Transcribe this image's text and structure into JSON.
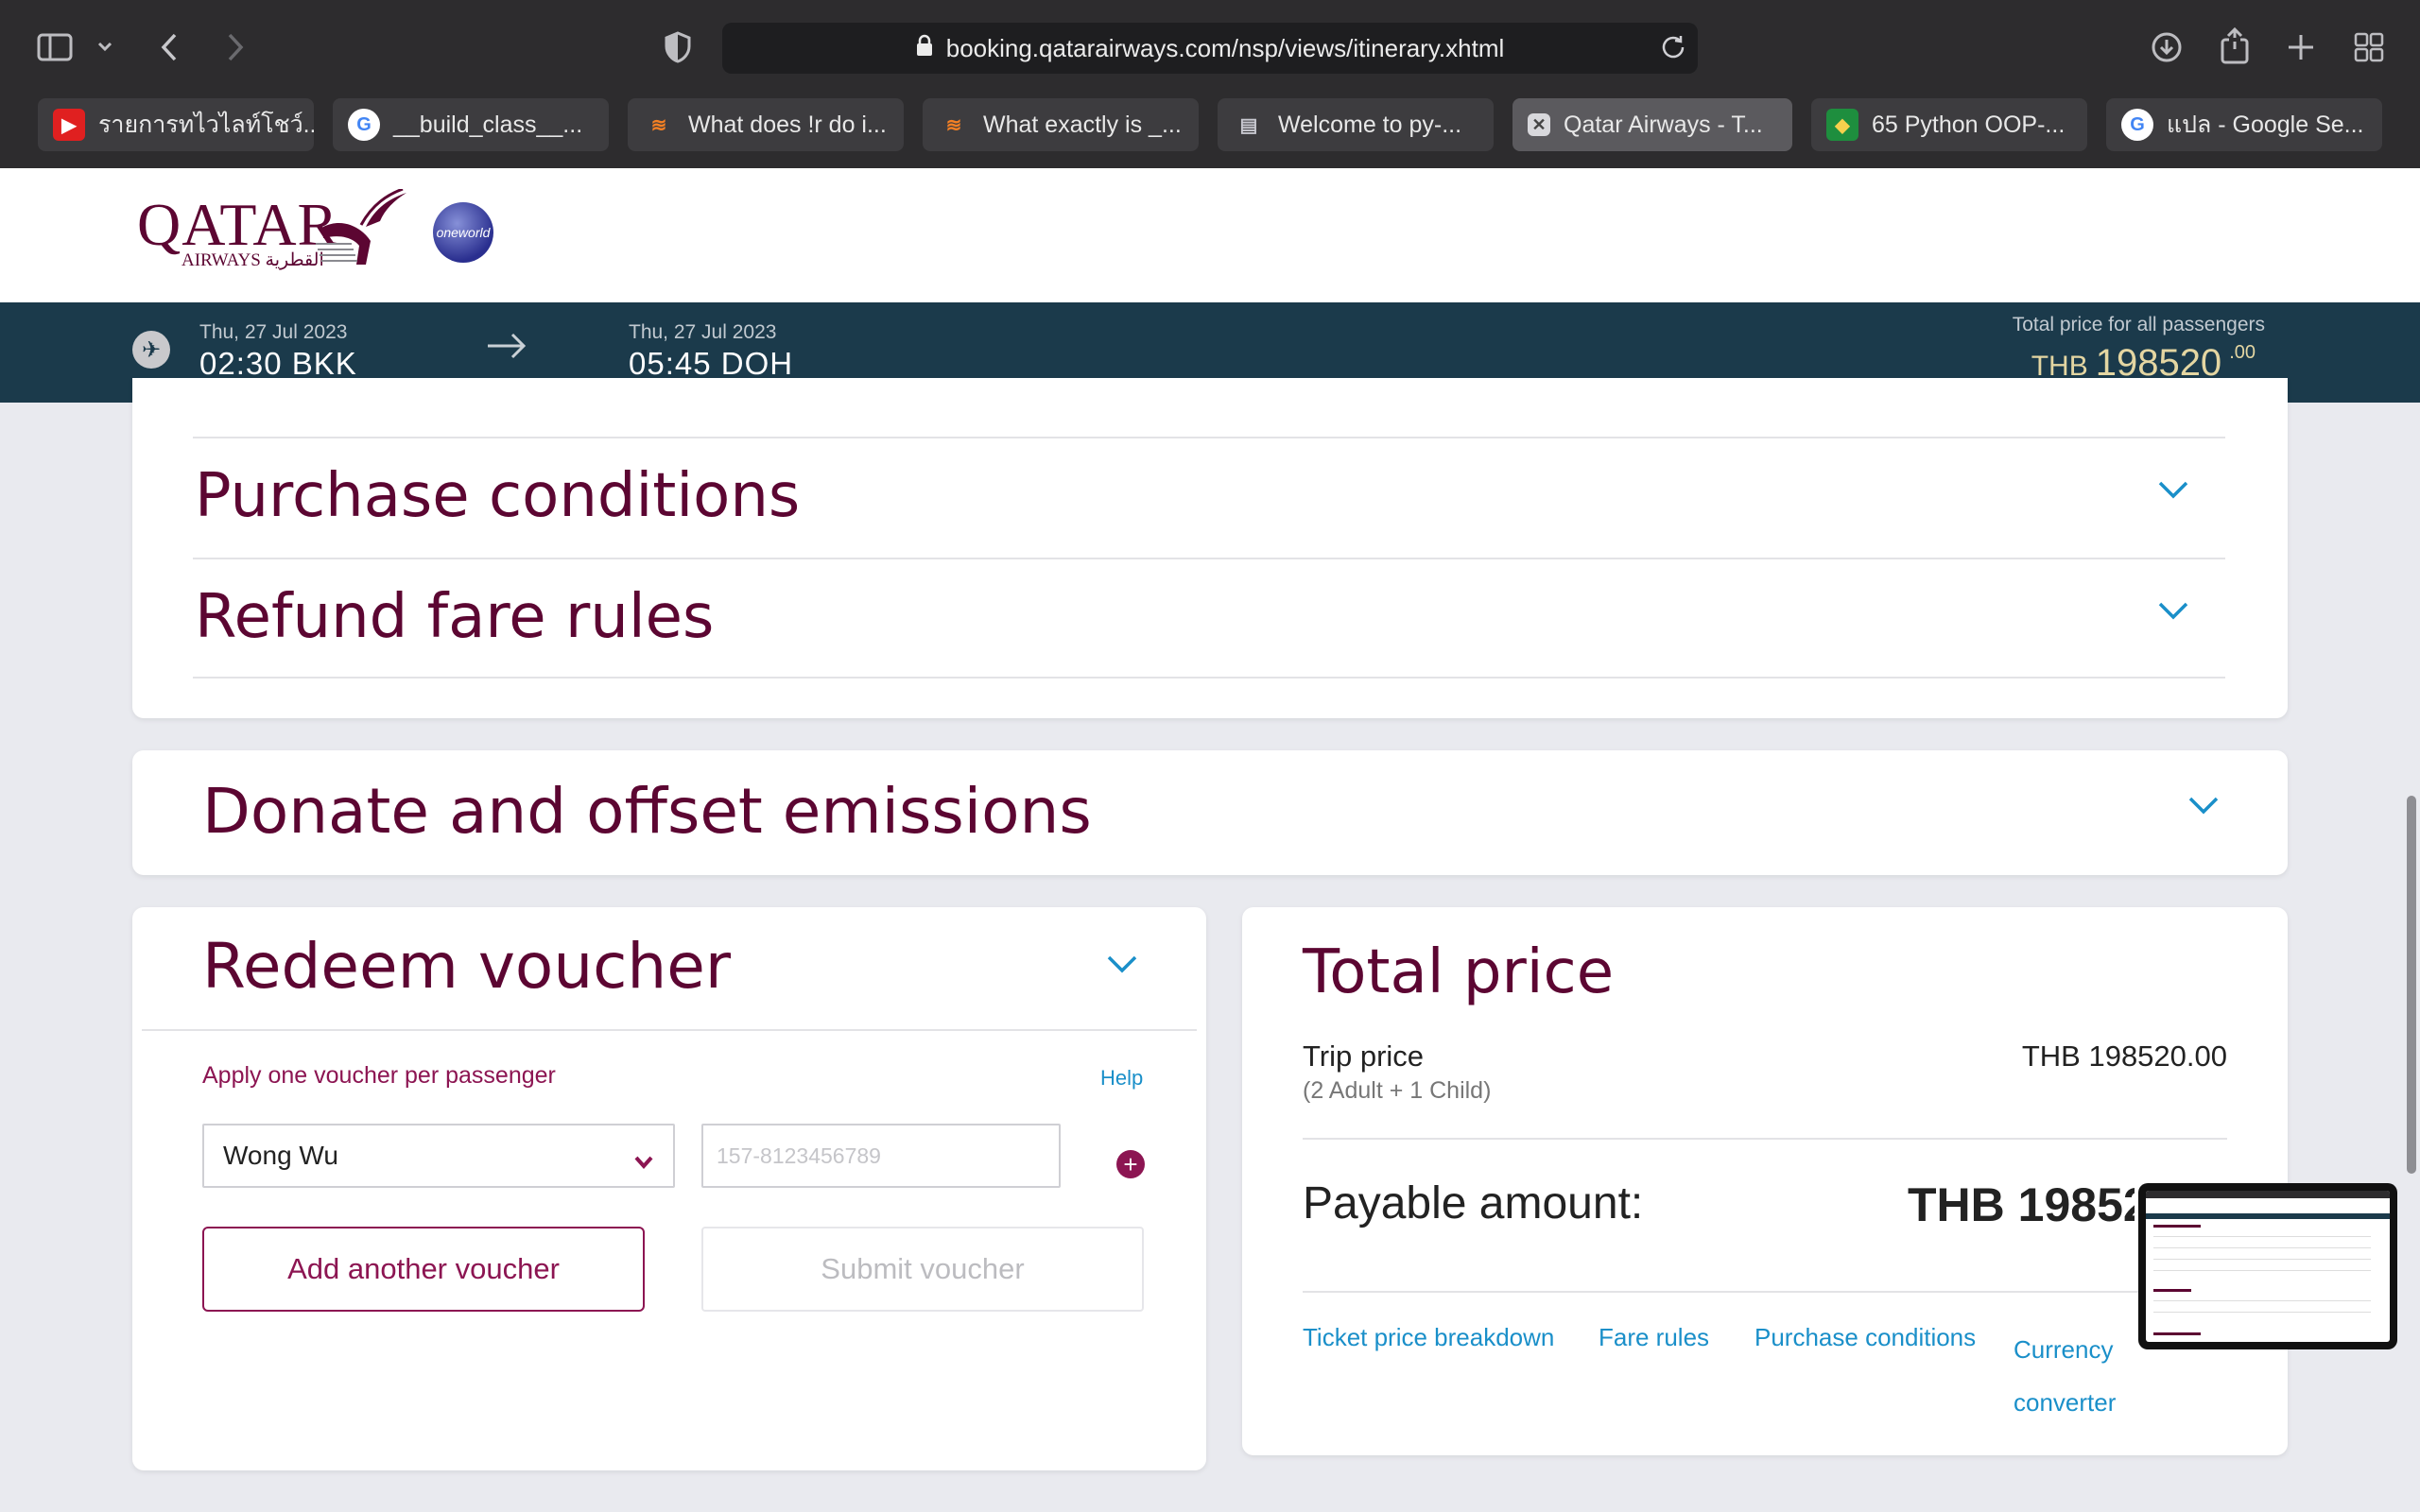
{
  "browser": {
    "url": "booking.qatarairways.com/nsp/views/itinerary.xhtml",
    "tabs": [
      {
        "title": "รายการทไวไลท์โชว์...",
        "icon": "youtube-icon",
        "active": false
      },
      {
        "title": "__build_class__...",
        "icon": "google-icon",
        "active": false
      },
      {
        "title": "What does !r do i...",
        "icon": "stackoverflow-icon",
        "active": false
      },
      {
        "title": "What exactly is _...",
        "icon": "stackoverflow-icon",
        "active": false
      },
      {
        "title": "Welcome to py-...",
        "icon": "docs-icon",
        "active": false
      },
      {
        "title": "Qatar Airways - T...",
        "icon": "close-icon",
        "active": true
      },
      {
        "title": "65 Python OOP-...",
        "icon": "classroom-icon",
        "active": false
      },
      {
        "title": "แปล - Google Se...",
        "icon": "google-icon",
        "active": false
      }
    ]
  },
  "header": {
    "logo_text": "QATAR",
    "logo_sub": "AIRWAYS القطرية",
    "alliance": "oneworld"
  },
  "itinerary": {
    "depart_date": "Thu, 27 Jul 2023",
    "depart_time": "02:30 BKK",
    "arrive_date": "Thu, 27 Jul 2023",
    "arrive_time": "05:45 DOH",
    "total_label": "Total price for all passengers",
    "total_currency": "THB",
    "total_amount": "198520",
    "total_decimals": ".00"
  },
  "sections": {
    "purchase_conditions": "Purchase conditions",
    "refund_fare_rules": "Refund fare rules",
    "donate": "Donate and offset emissions"
  },
  "voucher": {
    "title": "Redeem voucher",
    "instruction": "Apply one voucher per passenger",
    "help": "Help",
    "passenger_selected": "Wong Wu",
    "voucher_placeholder": "157-8123456789",
    "add_button": "Add another voucher",
    "submit_button": "Submit voucher"
  },
  "total_price": {
    "title": "Total price",
    "trip_label": "Trip price",
    "passengers": "(2 Adult + 1 Child)",
    "trip_amount": "THB 198520.00",
    "payable_label": "Payable amount:",
    "payable_amount": "THB 198520.00",
    "links": [
      "Ticket price breakdown",
      "Fare rules",
      "Purchase conditions",
      "Currency converter"
    ]
  },
  "colors": {
    "brand": "#5c0632",
    "accent": "#8c1552",
    "link": "#1a8fc9",
    "itinerary_bar": "#1b3a4b",
    "price_gold": "#e4d6a2"
  }
}
